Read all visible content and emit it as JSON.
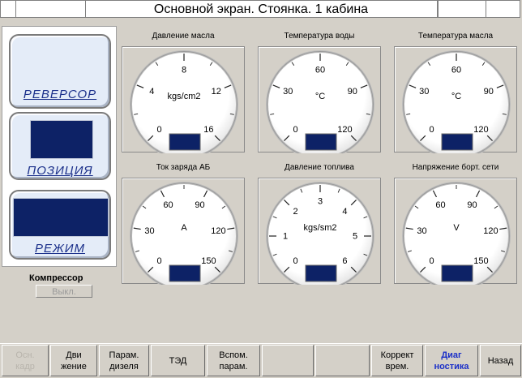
{
  "header": {
    "title": "Основной экран. Стоянка.  1 кабина"
  },
  "modes": {
    "reverser": "РЕВЕРСОР",
    "position": "ПОЗИЦИЯ",
    "mode": "РЕЖИМ"
  },
  "compressor": {
    "label": "Компрессор",
    "button": "Выкл."
  },
  "gauges": [
    {
      "title": "Давление масла",
      "unit": "kgs/cm2",
      "ticks": [
        "0",
        "4",
        "8",
        "12",
        "16"
      ],
      "min": 0,
      "max": 16
    },
    {
      "title": "Температура воды",
      "unit": "°C",
      "ticks": [
        "0",
        "30",
        "60",
        "90",
        "120"
      ],
      "min": 0,
      "max": 120
    },
    {
      "title": "Температура масла",
      "unit": "°C",
      "ticks": [
        "0",
        "30",
        "60",
        "90",
        "120"
      ],
      "min": 0,
      "max": 120
    },
    {
      "title": "Ток заряда АБ",
      "unit": "A",
      "ticks": [
        "0",
        "30",
        "60",
        "90",
        "120",
        "150"
      ],
      "min": 0,
      "max": 150
    },
    {
      "title": "Давление топлива",
      "unit": "kgs/sm2",
      "ticks": [
        "0",
        "1",
        "2",
        "3",
        "4",
        "5",
        "6"
      ],
      "min": 0,
      "max": 6
    },
    {
      "title": "Напряжение борт. сети",
      "unit": "V",
      "ticks": [
        "0",
        "30",
        "60",
        "90",
        "120",
        "150"
      ],
      "min": 0,
      "max": 150
    }
  ],
  "nav": [
    {
      "label": "Осн.\nкадр",
      "state": "disabled"
    },
    {
      "label": "Дви\nжение",
      "state": "normal"
    },
    {
      "label": "Парам.\nдизеля",
      "state": "normal"
    },
    {
      "label": "ТЭД",
      "state": "normal"
    },
    {
      "label": "Вспом.\nпарам.",
      "state": "normal"
    },
    {
      "label": "",
      "state": "normal"
    },
    {
      "label": "",
      "state": "normal"
    },
    {
      "label": "Коррект\nврем.",
      "state": "normal"
    },
    {
      "label": "Диаг\nностика",
      "state": "active"
    },
    {
      "label": "Назад",
      "state": "normal"
    }
  ],
  "colors": {
    "display": "#0d2266",
    "mode_label": "#1a2f8a",
    "active_nav": "#1a2fc8"
  }
}
